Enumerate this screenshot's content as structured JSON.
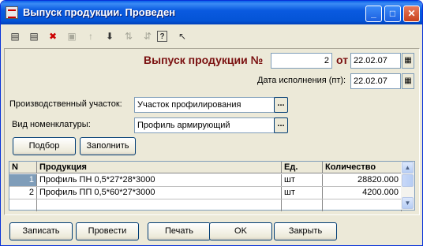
{
  "window": {
    "title": "Выпуск продукции. Проведен",
    "controls": {
      "minimize": "_",
      "maximize": "□",
      "close": "✕"
    }
  },
  "toolbar": {
    "icons": [
      "new-row-icon",
      "copy-row-icon",
      "delete-row-icon",
      "edit-row-icon",
      "move-up-icon",
      "move-down-icon",
      "sort-asc-icon",
      "sort-desc-icon",
      "help-icon",
      "context-help-icon"
    ]
  },
  "header": {
    "doc_label": "Выпуск продукции №",
    "doc_number": "2",
    "from_label": "от",
    "doc_date": "22.02.07",
    "exec_date_label": "Дата исполнения (пт):",
    "exec_date": "22.02.07"
  },
  "form": {
    "section_label": "Производственный участок:",
    "section_value": "Участок профилирования",
    "nomenclature_label": "Вид номенклатуры:",
    "nomenclature_value": "Профиль армирующий",
    "select_button": "..."
  },
  "actions_top": {
    "pick": "Подбор",
    "fill": "Заполнить"
  },
  "table": {
    "columns": [
      "N",
      "Продукция",
      "Ед.",
      "Количество"
    ],
    "rows": [
      {
        "n": "1",
        "product": "Профиль ПН 0,5*27*28*3000",
        "unit": "шт",
        "qty": "28820.000"
      },
      {
        "n": "2",
        "product": "Профиль ПП 0,5*60*27*3000",
        "unit": "шт",
        "qty": "4200.000"
      }
    ]
  },
  "actions_bottom": {
    "save": "Записать",
    "post": "Провести",
    "print": "Печать",
    "ok": "OK",
    "close": "Закрыть"
  }
}
